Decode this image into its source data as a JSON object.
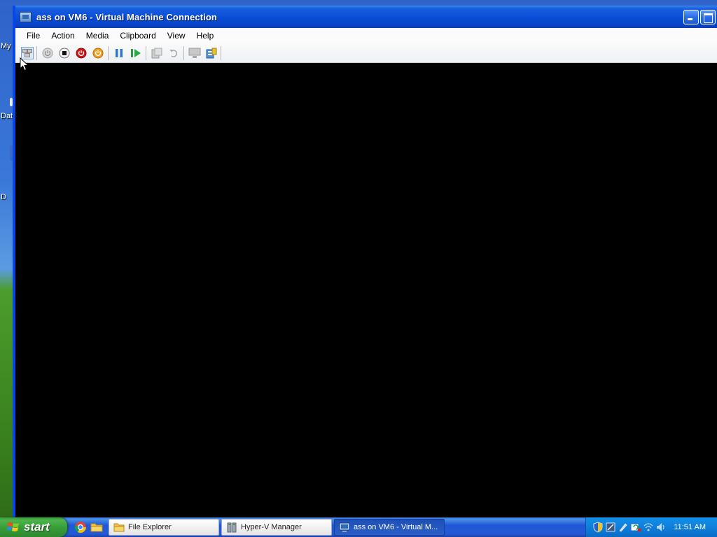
{
  "window": {
    "title": "ass on VM6 - Virtual Machine Connection"
  },
  "desktop": {
    "labels": [
      "My",
      "Dat",
      "D"
    ]
  },
  "menubar": {
    "items": [
      "File",
      "Action",
      "Media",
      "Clipboard",
      "View",
      "Help"
    ]
  },
  "toolbar": {
    "buttons": [
      {
        "name": "ctrl-alt-del-icon"
      },
      {
        "name": "start-icon"
      },
      {
        "name": "turn-off-icon"
      },
      {
        "name": "shut-down-icon"
      },
      {
        "name": "save-state-icon"
      },
      {
        "name": "pause-icon"
      },
      {
        "name": "resume-icon"
      },
      {
        "name": "snapshot-icon"
      },
      {
        "name": "revert-icon"
      },
      {
        "name": "enhanced-session-icon"
      },
      {
        "name": "settings-icon"
      }
    ]
  },
  "taskbar": {
    "start_label": "start",
    "tasks": [
      {
        "label": "File Explorer",
        "active": false
      },
      {
        "label": "Hyper-V Manager",
        "active": false
      },
      {
        "label": "ass on VM6 - Virtual M...",
        "active": true
      }
    ],
    "clock": "11:51 AM"
  },
  "colors": {
    "titlebar": "#0a4fd6",
    "taskbar": "#2459d6",
    "start_button": "#379b37",
    "tray": "#0f7fdc",
    "vm_screen": "#000000"
  }
}
